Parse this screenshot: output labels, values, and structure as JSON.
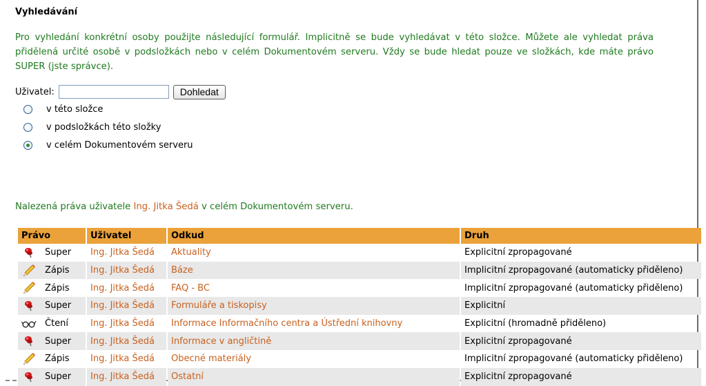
{
  "title": "Vyhledávání",
  "description": "Pro vyhledání konkrétní osoby použijte následující formulář. Implicitně se bude vyhledávat v této složce. Můžete ale vyhledat práva přidělená určité osobě v podsložkách nebo v celém Dokumentovém serveru. Vždy se bude hledat pouze ve složkách, kde máte právo SUPER (jste správce).",
  "form": {
    "user_label": "Uživatel:",
    "user_value": "",
    "search_button": "Dohledat",
    "scope_options": [
      {
        "label": "v této složce",
        "checked": false
      },
      {
        "label": "v podsložkách této složky",
        "checked": false
      },
      {
        "label": "v celém Dokumentovém serveru",
        "checked": true
      }
    ]
  },
  "result": {
    "prefix": "Nalezená práva uživatele ",
    "user": "Ing. Jitka Šedá",
    "suffix": " v celém Dokumentovém serveru."
  },
  "table": {
    "headers": {
      "right": "Právo",
      "user": "Uživatel",
      "from": "Odkud",
      "type": "Druh"
    },
    "rows": [
      {
        "icon": "pin-icon",
        "right": "Super",
        "user": "Ing. Jitka Šedá",
        "from": "Aktuality",
        "type": "Explicitní zpropagované"
      },
      {
        "icon": "pencil-icon",
        "right": "Zápis",
        "user": "Ing. Jitka Šedá",
        "from": "Báze",
        "type": "Implicitní zpropagované (automaticky přiděleno)"
      },
      {
        "icon": "pencil-icon",
        "right": "Zápis",
        "user": "Ing. Jitka Šedá",
        "from": "FAQ - BC",
        "type": "Implicitní zpropagované (automaticky přiděleno)"
      },
      {
        "icon": "pin-icon",
        "right": "Super",
        "user": "Ing. Jitka Šedá",
        "from": "Formuláře a tiskopisy",
        "type": "Explicitní"
      },
      {
        "icon": "glasses-icon",
        "right": "Čtení",
        "user": "Ing. Jitka Šedá",
        "from": "Informace Informačního centra a Ústřední knihovny",
        "type": "Explicitní (hromadně přiděleno)"
      },
      {
        "icon": "pin-icon",
        "right": "Super",
        "user": "Ing. Jitka Šedá",
        "from": "Informace v angličtině",
        "type": "Explicitní zpropagované"
      },
      {
        "icon": "pencil-icon",
        "right": "Zápis",
        "user": "Ing. Jitka Šedá",
        "from": "Obecné materiály",
        "type": "Implicitní zpropagované (automaticky přiděleno)"
      },
      {
        "icon": "pin-icon",
        "right": "Super",
        "user": "Ing. Jitka Šedá",
        "from": "Ostatní",
        "type": "Explicitní zpropagované"
      }
    ]
  },
  "colors": {
    "desc_text": "#1f7a1f",
    "link": "#c8601e",
    "header_bg": "#eba23a",
    "alt_row": "#e8e8e8"
  }
}
